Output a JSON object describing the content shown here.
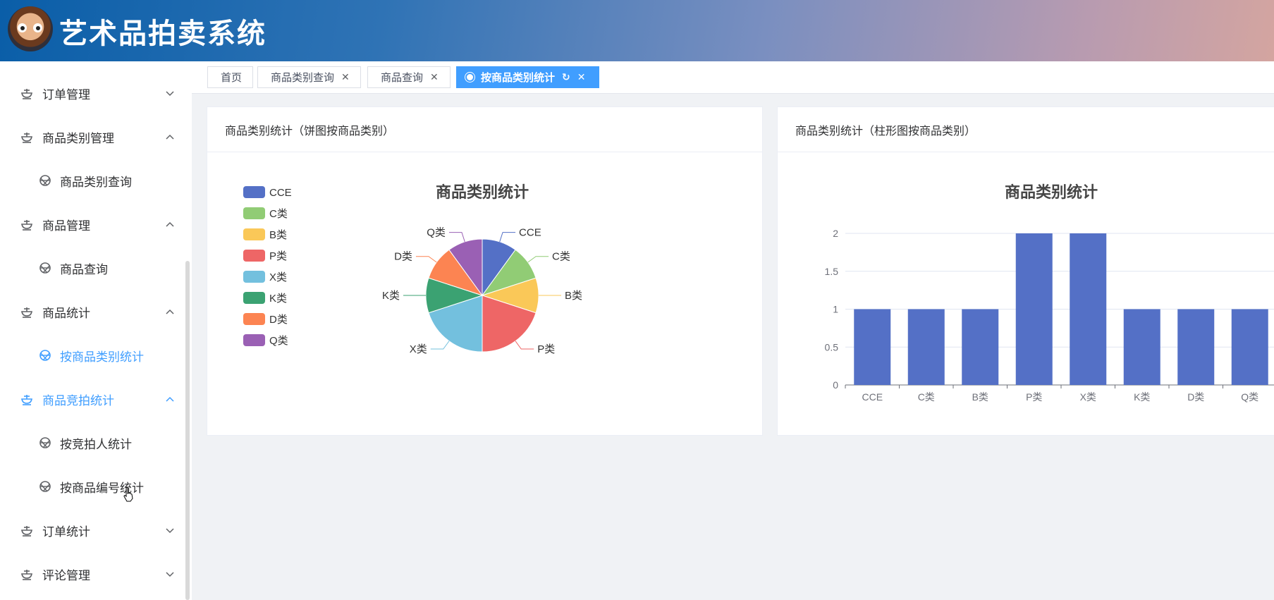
{
  "app": {
    "title": "艺术品拍卖系统"
  },
  "sidebar": {
    "items": [
      {
        "label": "订单管理",
        "level": 1,
        "expanded": false,
        "active": false
      },
      {
        "label": "商品类别管理",
        "level": 1,
        "expanded": true,
        "active": false
      },
      {
        "label": "商品类别查询",
        "level": 2,
        "active": false
      },
      {
        "label": "商品管理",
        "level": 1,
        "expanded": true,
        "active": false
      },
      {
        "label": "商品查询",
        "level": 2,
        "active": false
      },
      {
        "label": "商品统计",
        "level": 1,
        "expanded": true,
        "active": false
      },
      {
        "label": "按商品类别统计",
        "level": 2,
        "active": true
      },
      {
        "label": "商品竞拍统计",
        "level": 1,
        "expanded": true,
        "active": true
      },
      {
        "label": "按竞拍人统计",
        "level": 2,
        "active": false
      },
      {
        "label": "按商品编号统计",
        "level": 2,
        "active": false
      },
      {
        "label": "订单统计",
        "level": 1,
        "expanded": false,
        "active": false
      },
      {
        "label": "评论管理",
        "level": 1,
        "expanded": false,
        "active": false
      }
    ]
  },
  "tabs": [
    {
      "label": "首页",
      "closable": false,
      "active": false
    },
    {
      "label": "商品类别查询",
      "closable": true,
      "active": false
    },
    {
      "label": "商品查询",
      "closable": true,
      "active": false
    },
    {
      "label": "按商品类别统计",
      "closable": true,
      "active": true
    }
  ],
  "cards": {
    "pie_header": "商品类别统计（饼图按商品类别）",
    "bar_header": "商品类别统计（柱形图按商品类别）"
  },
  "colors": {
    "accent": "#409eff",
    "series": [
      "#5470c6",
      "#91cc75",
      "#fac858",
      "#ee6666",
      "#73c0de",
      "#3ba272",
      "#fc8452",
      "#9a60b4"
    ]
  },
  "chart_data": [
    {
      "type": "pie",
      "title": "商品类别统计",
      "legend_position": "left",
      "categories": [
        "CCE",
        "C类",
        "B类",
        "P类",
        "X类",
        "K类",
        "D类",
        "Q类"
      ],
      "values": [
        1,
        1,
        1,
        2,
        2,
        1,
        1,
        1
      ]
    },
    {
      "type": "bar",
      "title": "商品类别统计",
      "categories": [
        "CCE",
        "C类",
        "B类",
        "P类",
        "X类",
        "K类",
        "D类",
        "Q类"
      ],
      "values": [
        1,
        1,
        1,
        2,
        2,
        1,
        1,
        1
      ],
      "ylim": [
        0,
        2
      ],
      "yticks": [
        "0",
        "0.5",
        "1",
        "1.5",
        "2"
      ],
      "grid": true,
      "xlabel": "",
      "ylabel": ""
    }
  ]
}
